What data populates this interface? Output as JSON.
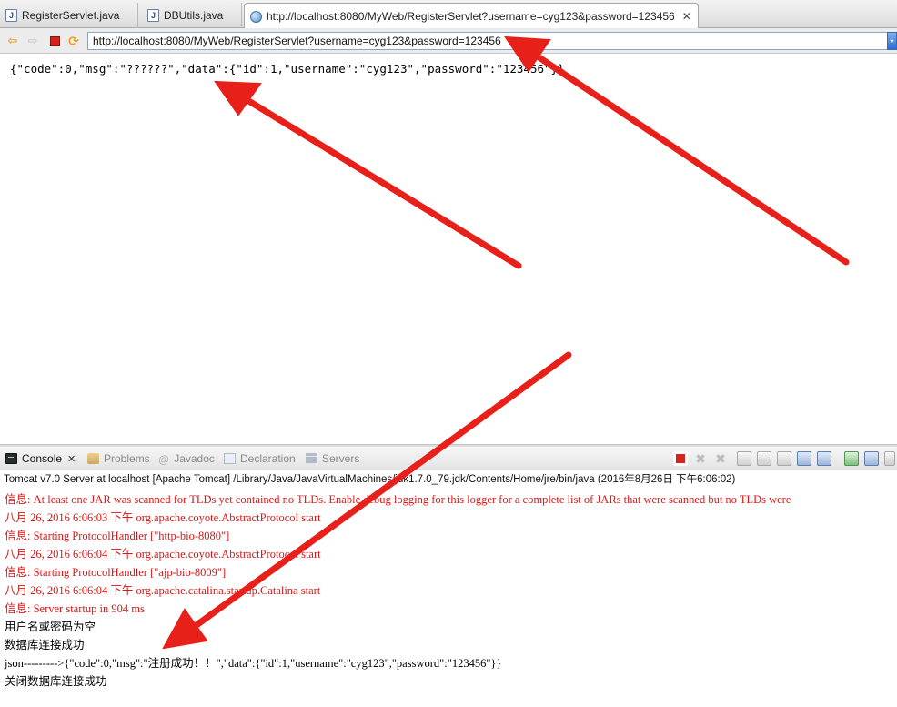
{
  "editor_tabs": [
    {
      "label": "RegisterServlet.java",
      "icon": "java-file-icon"
    },
    {
      "label": "DBUtils.java",
      "icon": "java-file-icon"
    },
    {
      "label": "http://localhost:8080/MyWeb/RegisterServlet?username=cyg123&password=123456",
      "icon": "globe-icon",
      "active": true
    }
  ],
  "browser": {
    "url": "http://localhost:8080/MyWeb/RegisterServlet?username=cyg123&password=123456"
  },
  "page_output": "{\"code\":0,\"msg\":\"??????\",\"data\":{\"id\":1,\"username\":\"cyg123\",\"password\":\"123456\"}}",
  "views": {
    "tabs": [
      {
        "label": "Console",
        "active": true
      },
      {
        "label": "Problems"
      },
      {
        "label": "Javadoc"
      },
      {
        "label": "Declaration"
      },
      {
        "label": "Servers"
      }
    ]
  },
  "console": {
    "label": "Tomcat v7.0 Server at localhost [Apache Tomcat] /Library/Java/JavaVirtualMachines/jdk1.7.0_79.jdk/Contents/Home/jre/bin/java (2016年8月26日 下午6:06:02)",
    "lines": [
      {
        "text": "信息: At least one JAR was scanned for TLDs yet contained no TLDs. Enable debug logging for this logger for a complete list of JARs that were scanned but no TLDs were",
        "color": "red"
      },
      {
        "text": "八月 26, 2016 6:06:03 下午 org.apache.coyote.AbstractProtocol start",
        "color": "red"
      },
      {
        "text": "信息: Starting ProtocolHandler [\"http-bio-8080\"]",
        "color": "red"
      },
      {
        "text": "八月 26, 2016 6:06:04 下午 org.apache.coyote.AbstractProtocol start",
        "color": "red"
      },
      {
        "text": "信息: Starting ProtocolHandler [\"ajp-bio-8009\"]",
        "color": "red"
      },
      {
        "text": "八月 26, 2016 6:06:04 下午 org.apache.catalina.startup.Catalina start",
        "color": "red"
      },
      {
        "text": "信息: Server startup in 904 ms",
        "color": "red"
      },
      {
        "text": "用户名或密码为空",
        "color": "black"
      },
      {
        "text": "数据库连接成功",
        "color": "black"
      },
      {
        "text": "json--------->{\"code\":0,\"msg\":\"注册成功！！\",\"data\":{\"id\":1,\"username\":\"cyg123\",\"password\":\"123456\"}}",
        "color": "black"
      },
      {
        "text": "关闭数据库连接成功",
        "color": "black"
      }
    ]
  },
  "colors": {
    "log_red": "#e01414",
    "arrow_red": "#e8201a"
  }
}
